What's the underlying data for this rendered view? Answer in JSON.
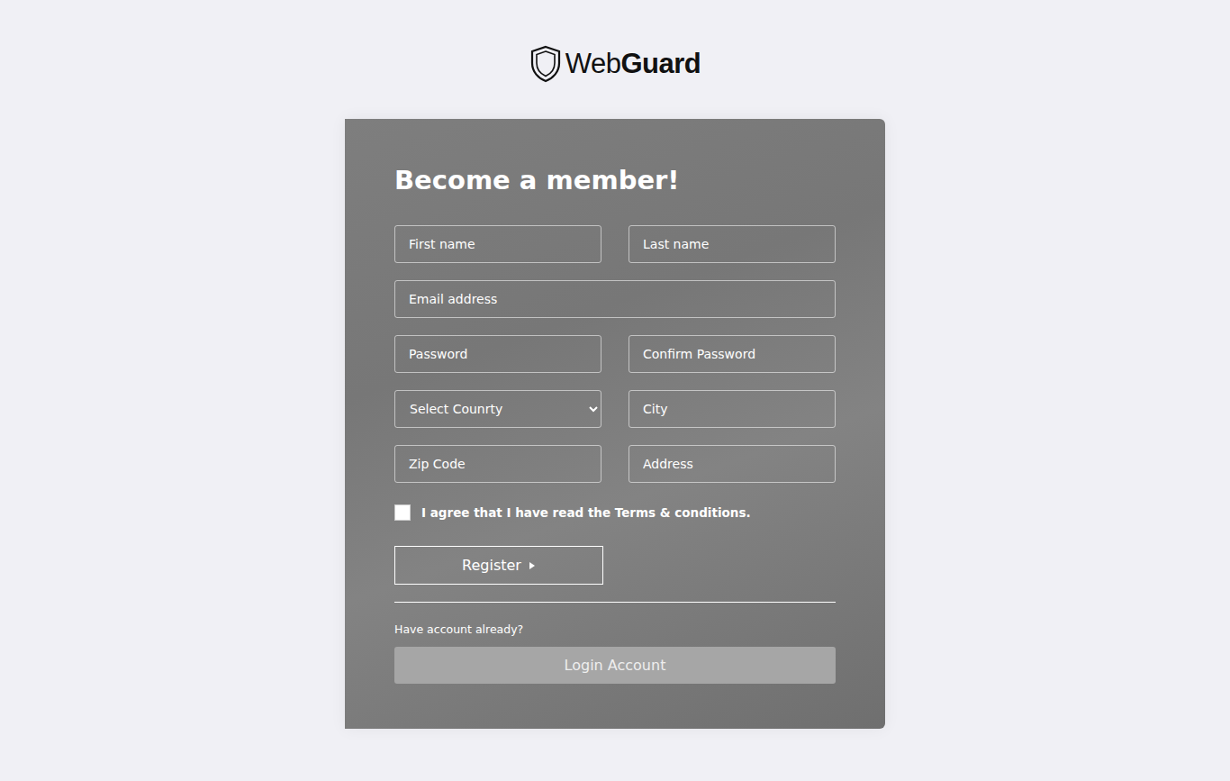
{
  "logo": {
    "text_light": "Web",
    "text_bold": "Guard"
  },
  "form": {
    "title": "Become a member!",
    "fields": [
      {
        "kind": "input",
        "placeholder": "First name",
        "wide": false
      },
      {
        "kind": "input",
        "placeholder": "Last name",
        "wide": false
      },
      {
        "kind": "input",
        "placeholder": "Email address",
        "wide": true
      },
      {
        "kind": "input",
        "placeholder": "Password",
        "wide": false
      },
      {
        "kind": "input",
        "placeholder": "Confirm Password",
        "wide": false
      },
      {
        "kind": "select",
        "placeholder": "Select Counrty",
        "wide": false
      },
      {
        "kind": "input",
        "placeholder": "City",
        "wide": false
      },
      {
        "kind": "input",
        "placeholder": "Zip Code",
        "wide": false
      },
      {
        "kind": "input",
        "placeholder": "Address",
        "wide": false
      }
    ],
    "terms": {
      "label": "I agree that I have read the Terms & conditions.",
      "checked": false
    },
    "register_button": "Register",
    "have_account": "Have account already?",
    "login_button": "Login Account"
  }
}
